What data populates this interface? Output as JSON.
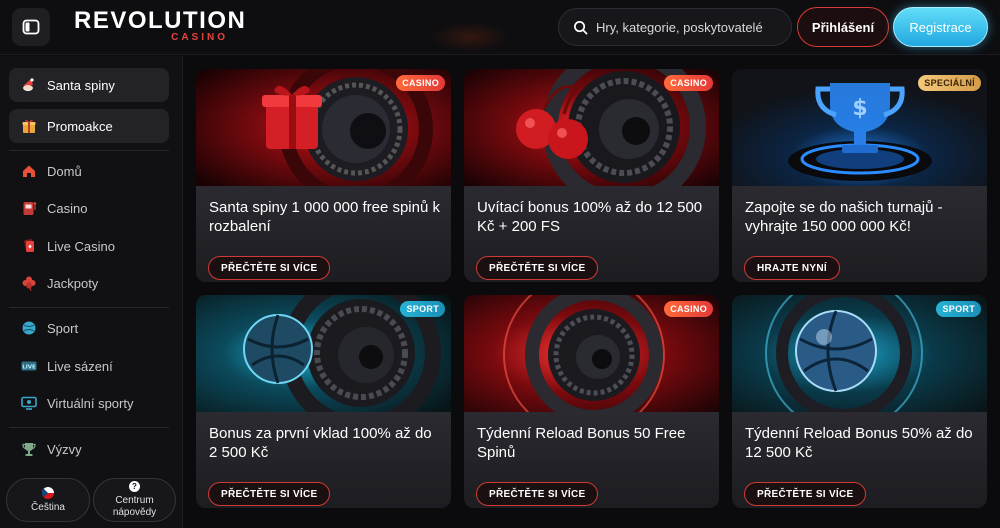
{
  "header": {
    "logo_main": "REVOLUTION",
    "logo_sub": "CASINO",
    "search_placeholder": "Hry, kategorie, poskytovatelé",
    "login_label": "Přihlášení",
    "register_label": "Registrace"
  },
  "sidebar": {
    "promo_items": [
      {
        "label": "Santa spiny",
        "icon": "santa-icon"
      },
      {
        "label": "Promoakce",
        "icon": "gift-icon"
      }
    ],
    "nav_items": [
      {
        "label": "Domů",
        "icon": "home-icon"
      },
      {
        "label": "Casino",
        "icon": "slot-machine-icon"
      },
      {
        "label": "Live Casino",
        "icon": "live-casino-icon"
      },
      {
        "label": "Jackpoty",
        "icon": "clover-icon"
      },
      {
        "label": "Sport",
        "icon": "ball-icon"
      },
      {
        "label": "Live sázení",
        "icon": "live-badge-icon"
      },
      {
        "label": "Virtuální sporty",
        "icon": "virtual-sports-icon"
      },
      {
        "label": "Výzvy",
        "icon": "challenge-icon"
      }
    ],
    "language_label": "Čeština",
    "help_label_line1": "Centrum",
    "help_label_line2": "nápovědy",
    "help_glyph": "?"
  },
  "cards": [
    {
      "badge": "CASINO",
      "badge_type": "casino",
      "title": "Santa spiny 1 000 000 free spinů k rozbalení",
      "button": "PŘEČTĚTE SI VÍCE"
    },
    {
      "badge": "CASINO",
      "badge_type": "casino",
      "title": "Uvítací bonus 100% až do 12 500 Kč + 200 FS",
      "button": "PŘEČTĚTE SI VÍCE"
    },
    {
      "badge": "SPECIÁLNÍ",
      "badge_type": "special",
      "title": "Zapojte se do našich turnajů - vyhrajte 150 000 000 Kč!",
      "button": "HRAJTE NYNÍ"
    },
    {
      "badge": "SPORT",
      "badge_type": "sport",
      "title": "Bonus za první vklad 100% až do 2 500 Kč",
      "button": "PŘEČTĚTE SI VÍCE"
    },
    {
      "badge": "CASINO",
      "badge_type": "casino",
      "title": "Týdenní Reload Bonus 50 Free Spinů",
      "button": "PŘEČTĚTE SI VÍCE"
    },
    {
      "badge": "SPORT",
      "badge_type": "sport",
      "title": "Týdenní Reload Bonus 50% až do 12 500 Kč",
      "button": "PŘEČTĚTE SI VÍCE"
    }
  ],
  "colors": {
    "accent_red": "#d73c36",
    "accent_cyan": "#3cc6f0",
    "background": "#0b0b0d"
  }
}
